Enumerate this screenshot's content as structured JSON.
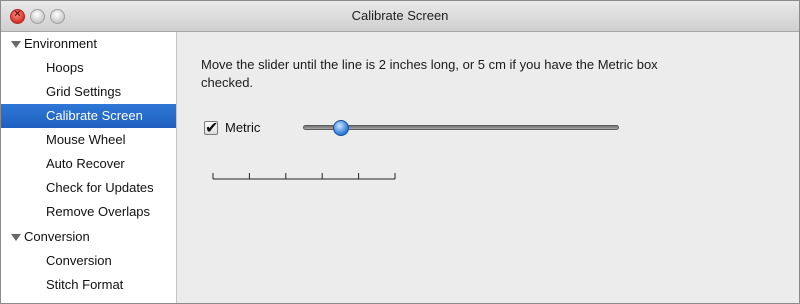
{
  "window": {
    "title": "Calibrate Screen"
  },
  "sidebar": {
    "groups": [
      {
        "label": "Environment",
        "items": [
          {
            "label": "Hoops"
          },
          {
            "label": "Grid Settings"
          },
          {
            "label": "Calibrate Screen",
            "selected": true
          },
          {
            "label": "Mouse Wheel"
          },
          {
            "label": "Auto Recover"
          },
          {
            "label": "Check for Updates"
          },
          {
            "label": "Remove Overlaps"
          }
        ]
      },
      {
        "label": "Conversion",
        "items": [
          {
            "label": "Conversion"
          },
          {
            "label": "Stitch Format"
          }
        ]
      }
    ]
  },
  "main": {
    "instructions": "Move the slider until the line is 2 inches long, or 5 cm if you have the Metric box checked.",
    "metric_checkbox": {
      "label": "Metric",
      "checked": true,
      "check_glyph": "✔"
    },
    "calibration_slider": {
      "value": 0.1
    },
    "ruler": {
      "segments": 5
    }
  },
  "colors": {
    "selection": "#1f5fbf",
    "slider_thumb": "#3b86e0"
  },
  "icons": {
    "close": "close-button-icon",
    "minimize": "minimize-button-icon",
    "zoom": "zoom-button-icon",
    "disclosure": "disclosure-triangle-icon",
    "checkmark": "checkmark-icon"
  }
}
